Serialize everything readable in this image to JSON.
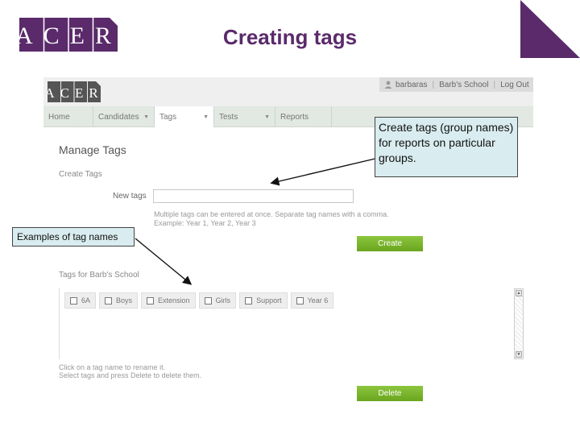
{
  "slide": {
    "title": "Creating tags",
    "logo_text": "ACER"
  },
  "app": {
    "logo_text": "ACER",
    "user": {
      "name": "barbaras",
      "school": "Barb's School",
      "logout": "Log Out"
    },
    "nav": [
      {
        "label": "Home",
        "has_caret": false
      },
      {
        "label": "Candidates",
        "has_caret": true
      },
      {
        "label": "Tags",
        "has_caret": true,
        "active": true
      },
      {
        "label": "Tests",
        "has_caret": true
      },
      {
        "label": "Reports",
        "has_caret": false
      }
    ],
    "page_heading": "Manage Tags",
    "create_heading": "Create Tags",
    "new_tag_label": "New tags",
    "new_tag_value": "",
    "hint_line1": "Multiple tags can be entered at once. Separate tag names with a comma.",
    "hint_line2": "Example: Year 1, Year 2, Year 3",
    "create_button": "Create",
    "tags_heading": "Tags for Barb's School",
    "tags": [
      "6A",
      "Boys",
      "Extension",
      "Girls",
      "Support",
      "Year 6"
    ],
    "hint_line3": "Click on a tag name to rename it.",
    "hint_line4": "Select tags and press Delete to delete them.",
    "delete_button": "Delete"
  },
  "callouts": {
    "create_tags": "Create tags (group names) for reports on particular groups.",
    "examples": "Examples of tag names"
  },
  "colors": {
    "brand_purple": "#5a2a6b",
    "button_green": "#7cb82f",
    "callout_fill": "#d9ecef"
  }
}
